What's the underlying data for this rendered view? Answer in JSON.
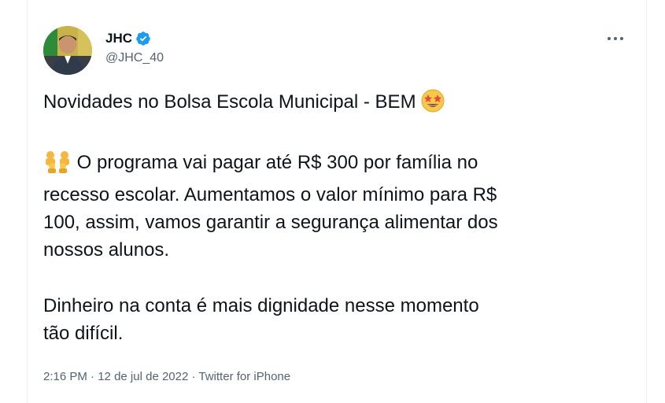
{
  "author": {
    "display_name": "JHC",
    "handle": "@JHC_40",
    "verified": true,
    "avatar_icon": "profile-photo"
  },
  "more_icon": "more-options-icon",
  "tweet": {
    "line1": "Novidades no Bolsa Escola Municipal - BEM",
    "line1_emoji": "star-struck-emoji",
    "para2_emoji": "family-emoji",
    "para2": "O programa vai pagar até R$ 300 por família no",
    "para2_l2": "recesso escolar. Aumentamos o valor mínimo para R$",
    "para2_l3": "100, assim, vamos garantir a segurança alimentar dos",
    "para2_l4": "nossos alunos.",
    "para3_l1": "Dinheiro na conta é mais dignidade nesse momento",
    "para3_l2": "tão difícil."
  },
  "meta": {
    "time": "2:16 PM",
    "sep1": " · ",
    "date": "12 de jul de 2022",
    "sep2": " · ",
    "source": "Twitter for iPhone"
  },
  "colors": {
    "verified_blue": "#1d9bf0",
    "text": "#0f1419",
    "secondary": "#536471"
  }
}
